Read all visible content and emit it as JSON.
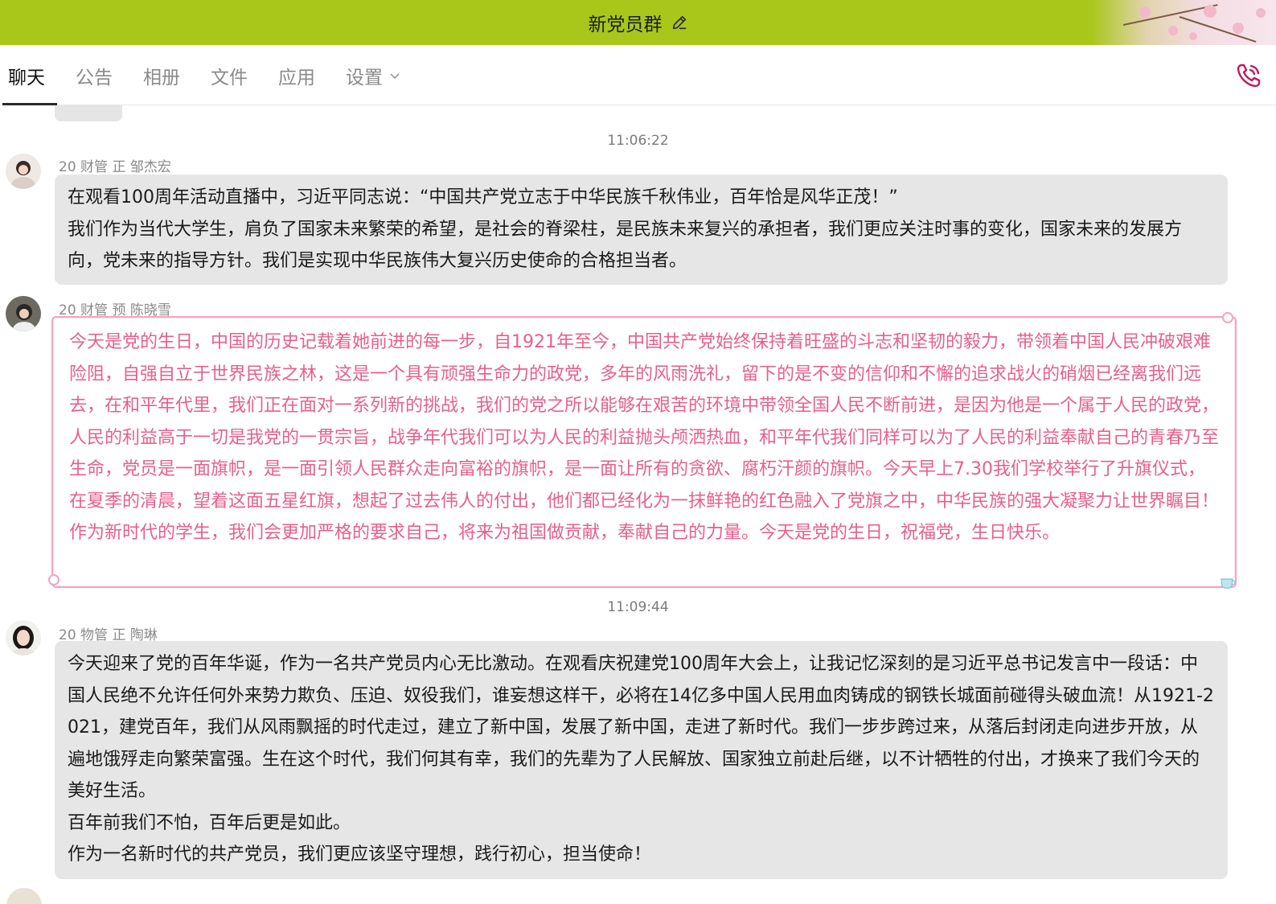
{
  "window": {
    "title": "新党员群"
  },
  "tabs": [
    {
      "label": "聊天",
      "active": true
    },
    {
      "label": "公告",
      "active": false
    },
    {
      "label": "相册",
      "active": false
    },
    {
      "label": "文件",
      "active": false
    },
    {
      "label": "应用",
      "active": false
    },
    {
      "label": "设置",
      "active": false
    }
  ],
  "icons": {
    "edit": "edit-icon",
    "settings_dropdown": "chevron-down-icon",
    "call": "phone-icon",
    "bubble_decoration": "teacup-icon"
  },
  "colors": {
    "titlebar": "#a8c71a",
    "pink_text": "#e85f8a",
    "pink_border": "#f6a3be",
    "gray_bubble": "#e6e6e6",
    "phone_icon": "#c2185b"
  },
  "messages": [
    {
      "timestamp": "11:06:22",
      "sender": "20 财管 正 邹杰宏",
      "text": "在观看100周年活动直播中，习近平同志说：“中国共产党立志于中华民族千秋伟业，百年恰是风华正茂！”\n我们作为当代大学生，肩负了国家未来繁荣的希望，是社会的脊梁柱，是民族未来复兴的承担者，我们更应关注时事的变化，国家未来的发展方向，党未来的指导方针。我们是实现中华民族伟大复兴历史使命的合格担当者。"
    },
    {
      "sender": "20 财管 预 陈晓雪",
      "text": "今天是党的生日，中国的历史记载着她前进的每一步，自1921年至今，中国共产党始终保持着旺盛的斗志和坚韧的毅力，带领着中国人民冲破艰难险阻，自强自立于世界民族之林，这是一个具有顽强生命力的政党，多年的风雨洗礼，留下的是不变的信仰和不懈的追求战火的硝烟已经离我们远去，在和平年代里，我们正在面对一系列新的挑战，我们的党之所以能够在艰苦的环境中带领全国人民不断前进，是因为他是一个属于人民的政党，人民的利益高于一切是我党的一贯宗旨，战争年代我们可以为人民的利益抛头颅洒热血，和平年代我们同样可以为了人民的利益奉献自己的青春乃至生命，党员是一面旗帜，是一面引领人民群众走向富裕的旗帜，是一面让所有的贪欲、腐朽汗颜的旗帜。今天早上7.30我们学校举行了升旗仪式，在夏季的清晨，望着这面五星红旗，想起了过去伟人的付出，他们都已经化为一抹鲜艳的红色融入了党旗之中，中华民族的强大凝聚力让世界瞩目！\n作为新时代的学生，我们会更加严格的要求自己，将来为祖国做贡献，奉献自己的力量。今天是党的生日，祝福党，生日快乐。"
    },
    {
      "timestamp": "11:09:44",
      "sender": "20 物管 正 陶琳",
      "text": "今天迎来了党的百年华诞，作为一名共产党员内心无比激动。在观看庆祝建党100周年大会上，让我记忆深刻的是习近平总书记发言中一段话：中国人民绝不允许任何外来势力欺负、压迫、奴役我们，谁妄想这样干，必将在14亿多中国人民用血肉铸成的钢铁长城面前碰得头破血流！从1921-2021，建党百年，我们从风雨飘摇的时代走过，建立了新中国，发展了新中国，走进了新时代。我们一步步跨过来，从落后封闭走向进步开放，从遍地饿殍走向繁荣富强。生在这个时代，我们何其有幸，我们的先辈为了人民解放、国家独立前赴后继，以不计牺牲的付出，才换来了我们今天的美好生活。\n百年前我们不怕，百年后更是如此。\n作为一名新时代的共产党员，我们更应该坚守理想，践行初心，担当使命！"
    }
  ]
}
